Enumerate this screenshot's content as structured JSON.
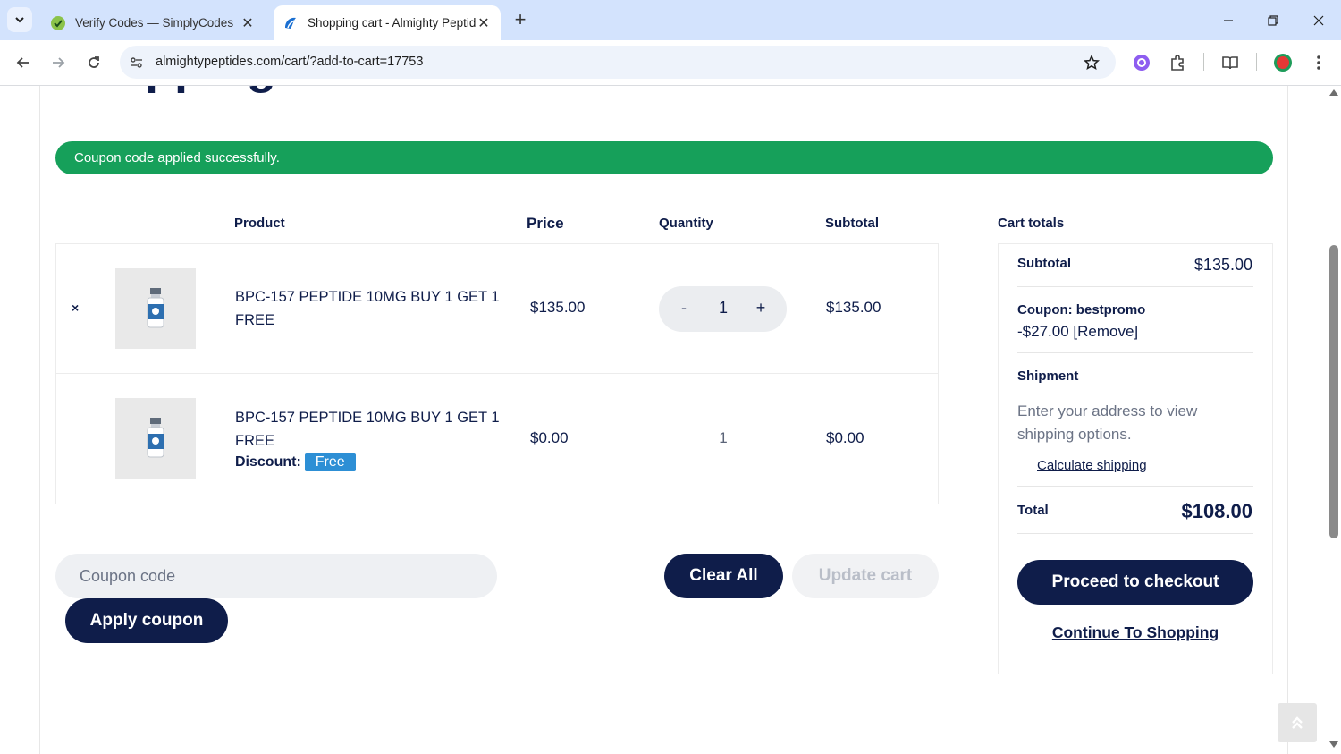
{
  "browser": {
    "tabs": [
      {
        "title": "Verify Codes — SimplyCodes",
        "active": false
      },
      {
        "title": "Shopping cart - Almighty Peptides",
        "active": true
      }
    ],
    "url": "almightypeptides.com/cart/?add-to-cart=17753"
  },
  "page": {
    "heading": "Shopping cart",
    "notice": "Coupon code applied successfully.",
    "table_headers": {
      "product": "Product",
      "price": "Price",
      "quantity": "Quantity",
      "subtotal": "Subtotal"
    },
    "items": [
      {
        "remove": "×",
        "name": "BPC-157 PEPTIDE 10MG BUY 1 GET 1 FREE",
        "price": "$135.00",
        "quantity": "1",
        "subtotal": "$135.00",
        "qty_minus": "-",
        "qty_plus": "+"
      },
      {
        "name": "BPC-157 PEPTIDE 10MG BUY 1 GET 1 FREE",
        "discount_label": "Discount:",
        "discount_badge": "Free",
        "price": "$0.00",
        "quantity": "1",
        "subtotal": "$0.00"
      }
    ],
    "coupon": {
      "placeholder": "Coupon code",
      "apply_label": "Apply coupon"
    },
    "actions": {
      "clear_all": "Clear All",
      "update_cart": "Update cart"
    },
    "totals": {
      "title": "Cart totals",
      "subtotal_label": "Subtotal",
      "subtotal_value": "$135.00",
      "coupon_label": "Coupon: bestpromo",
      "coupon_amount": "-$27.00",
      "coupon_remove": "[Remove]",
      "shipment_label": "Shipment",
      "shipment_text": "Enter your address to view shipping options.",
      "calculate_shipping": "Calculate shipping",
      "total_label": "Total",
      "total_value": "$108.00",
      "checkout": "Proceed to checkout",
      "continue": "Continue To Shopping"
    }
  },
  "colors": {
    "navy": "#0f1d4a",
    "success_green": "#16a05a",
    "badge_blue": "#2d8fd5",
    "tabstrip": "#d3e3fd"
  }
}
